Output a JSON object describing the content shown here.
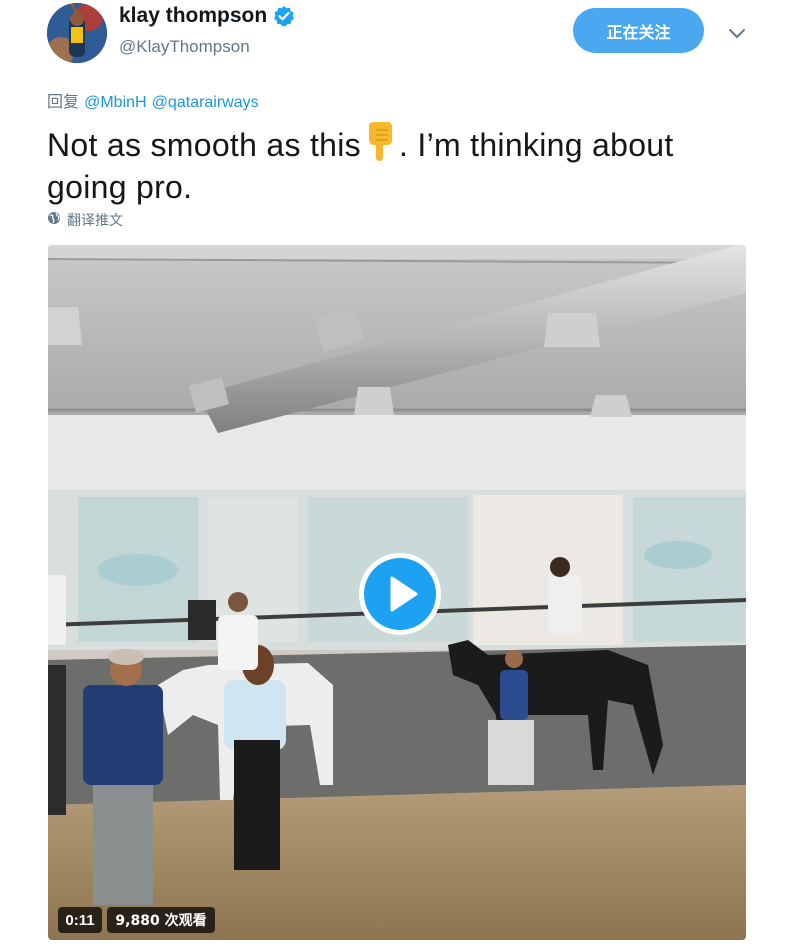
{
  "user": {
    "display_name": "klay thompson",
    "handle": "@KlayThompson",
    "verified_icon": "verified-badge-icon"
  },
  "follow_label": "正在关注",
  "reply": {
    "prefix": "回复",
    "mentions": [
      "@MbinH",
      "@qatarairways"
    ]
  },
  "tweet": {
    "text_before": "Not as smooth as this",
    "emoji": "backhand-index-pointing-down",
    "text_after": ". I’m thinking about going pro."
  },
  "translate_label": "翻译推文",
  "video": {
    "duration": "0:11",
    "views": "9,880 次观看"
  },
  "colors": {
    "accent": "#1da1f2",
    "follow_button": "#4aa8f0",
    "mention": "#1b95e0",
    "secondary_text": "#657786"
  }
}
